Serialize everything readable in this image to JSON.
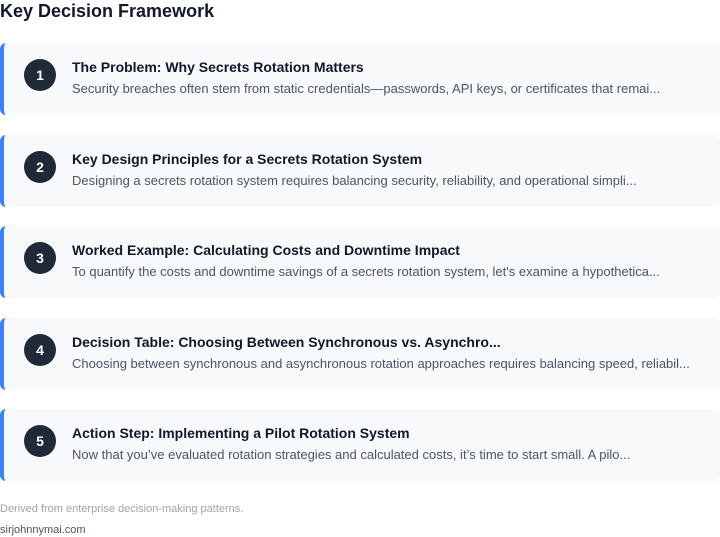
{
  "page_title": "Key Decision Framework",
  "cards": [
    {
      "number": "1",
      "title": "The Problem: Why Secrets Rotation Matters",
      "description": "Security breaches often stem from static credentials—passwords, API keys, or certificates that remai..."
    },
    {
      "number": "2",
      "title": "Key Design Principles for a Secrets Rotation System",
      "description": "Designing a secrets rotation system requires balancing security, reliability, and operational simpli..."
    },
    {
      "number": "3",
      "title": "Worked Example: Calculating Costs and Downtime Impact",
      "description": "To quantify the costs and downtime savings of a secrets rotation system, let's examine a hypothetica..."
    },
    {
      "number": "4",
      "title": "Decision Table: Choosing Between Synchronous vs. Asynchro...",
      "description": "Choosing between synchronous and asynchronous rotation approaches requires balancing speed, reliabil..."
    },
    {
      "number": "5",
      "title": "Action Step: Implementing a Pilot Rotation System",
      "description": "Now that you’ve evaluated rotation strategies and calculated costs, it’s time to start small. A pilo..."
    }
  ],
  "footer": {
    "note": "Derived from enterprise decision-making patterns.",
    "domain": "sirjohnnymai.com"
  },
  "colors": {
    "accent": "#3b82f6",
    "badge": "#1f2937",
    "card_background": "#f8f9fb"
  }
}
